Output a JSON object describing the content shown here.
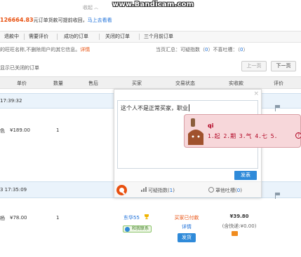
{
  "header": {
    "top_link": "收起",
    "watermark": "www.Bandicam.com"
  },
  "notice": {
    "amount": "126664.83",
    "text": "元订单货款可提前收回，",
    "link": "马上去看看"
  },
  "tabs": [
    "退款中",
    "需要评价",
    "成功的订单",
    "关闭的订单",
    "三个月前订单"
  ],
  "tip": {
    "text": "的旺旺名称,不删除用户的其它信息。",
    "warn": "详情"
  },
  "summary": {
    "prefix": "当页汇总：可疑指数（",
    "suspicious": "0",
    "mid": "）不喜吐槽：（",
    "complaints": "0",
    "suffix": "）"
  },
  "filters": {
    "show_closed": "显示已关闭的订单"
  },
  "pager": {
    "prev": "上一页",
    "next": "下一页"
  },
  "columns": [
    "单价",
    "数量",
    "售后",
    "买家",
    "交易状态",
    "实收款",
    "评价"
  ],
  "orders": [
    {
      "time": "17:39:32",
      "price": "¥189.00",
      "qty": "1",
      "name_frag": "色"
    },
    {
      "time": "3 17:35:09",
      "price": "¥78.00",
      "qty": "1",
      "name_frag": "杨",
      "buyer": "东华55",
      "buyer_badge": "和我联系",
      "status": "买家已付款",
      "status_detail": "详情",
      "ship_label": "发货",
      "amount": "¥39.80",
      "postage": "(含快递:¥0.00)"
    }
  ],
  "popup": {
    "close": "×",
    "text": "这个人不是正常买家，职业",
    "send": "发表",
    "suspicious_label": "可疑指数(",
    "suspicious_val": "1",
    "suspicious_close": ")",
    "complaint_label": "罩他吐槽(",
    "complaint_val": "0",
    "complaint_close": ")"
  },
  "ime": {
    "composition": "qi",
    "candidates": "1.起 2.期 3.气 4.七 5.",
    "extra": "?"
  },
  "colors": {
    "accent": "#e8500f",
    "link": "#1a6ed8",
    "send_button": "#2f8ad9",
    "ime_bg": "#f7d7da"
  }
}
